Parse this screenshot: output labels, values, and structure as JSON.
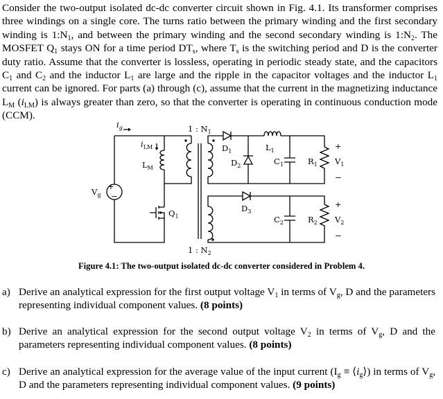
{
  "problem": {
    "intro_parts": [
      "Consider the two-output isolated dc-dc converter circuit shown in Fig. 4.1. Its transformer comprises three windings on a single core. The turns ratio between the primary winding and the first secondary winding is 1:N",
      "1",
      ", and between the primary winding and the second secondary winding is 1:N",
      "2",
      ". The MOSFET Q",
      "1",
      " stays ON for a time period DT",
      "s",
      ", where T",
      "s",
      " is the switching period and D is the converter duty ratio. Assume that the converter is lossless, operating in periodic steady state, and the capacitors C",
      "1",
      " and C",
      "2",
      " and the inductor L",
      "1",
      " are large and the ripple in the capacitor voltages and the inductor L",
      "1",
      " current can be ignored. For parts (a) through (c), assume that the current in the magnetizing inductance L",
      "M",
      " (",
      "i",
      "LM",
      ") is always greater than zero, so that the converter is operating in continuous conduction mode (CCM)."
    ]
  },
  "figure": {
    "labels": {
      "ig": "i",
      "ig_sub": "g",
      "ilm": "i",
      "ilm_sub": "LM",
      "lm": "L",
      "lm_sub": "M",
      "vg": "V",
      "vg_sub": "g",
      "q1": "Q",
      "q1_sub": "1",
      "ratio1": "1 : N",
      "ratio1_sub": "1",
      "ratio2": "1 : N",
      "ratio2_sub": "2",
      "d1": "D",
      "d1_sub": "1",
      "d2": "D",
      "d2_sub": "2",
      "d3": "D",
      "d3_sub": "3",
      "l1": "L",
      "l1_sub": "1",
      "c1": "C",
      "c1_sub": "1",
      "c2": "C",
      "c2_sub": "2",
      "r1": "R",
      "r1_sub": "1",
      "r2": "R",
      "r2_sub": "2",
      "v1": "V",
      "v1_sub": "1",
      "v2": "V",
      "v2_sub": "2",
      "plus": "+",
      "minus": "−",
      "src_plus": "+",
      "src_minus": "−"
    },
    "caption": "Figure 4.1: The two-output isolated dc-dc converter considered in Problem 4."
  },
  "questions": [
    {
      "label": "a)",
      "parts": [
        "Derive an analytical expression for the first output voltage V",
        "1",
        " in terms of V",
        "g",
        ", D and the parameters representing individual component values. "
      ],
      "points": "(8 points)"
    },
    {
      "label": "b)",
      "parts": [
        "Derive an analytical expression for the second output voltage V",
        "2",
        " in terms of V",
        "g",
        ", D and the parameters representing individual component values. "
      ],
      "points": "(8 points)"
    },
    {
      "label": "c)",
      "parts": [
        "Derive an analytical expression for the average value of the input current (I",
        "g",
        " ≡ ⟨",
        "i",
        "g",
        "⟩) in terms of V",
        "g",
        ", D and the parameters representing individual component values. "
      ],
      "points": "(9 points)"
    }
  ]
}
